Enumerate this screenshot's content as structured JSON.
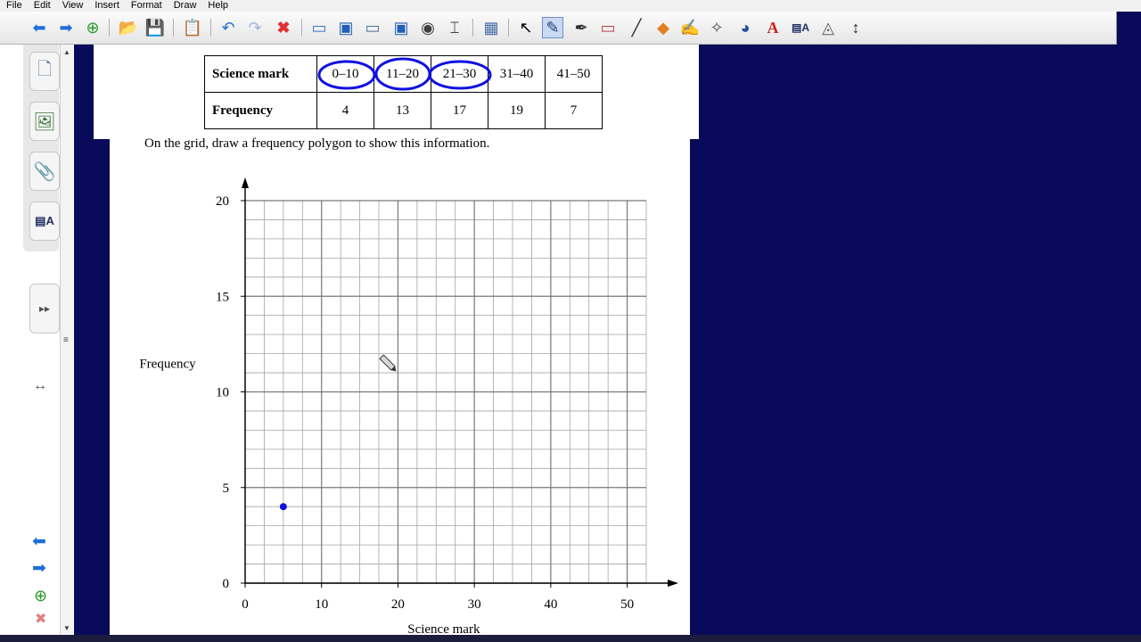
{
  "menu": [
    "File",
    "Edit",
    "View",
    "Insert",
    "Format",
    "Draw",
    "Help"
  ],
  "toolbar_icons": [
    "back-arrow-icon",
    "forward-arrow-icon",
    "add-page-icon",
    "open-folder-icon",
    "save-icon",
    "paste-icon",
    "undo-icon",
    "redo-icon",
    "delete-icon",
    "screen-shade-icon",
    "full-screen-icon",
    "dual-display-icon",
    "screen-capture-icon",
    "record-icon",
    "spotlight-icon",
    "table-icon",
    "select-arrow-icon",
    "pen-icon",
    "creative-pen-icon",
    "eraser-icon",
    "line-icon",
    "shape-icon",
    "magic-pen-icon",
    "recognition-pen-icon",
    "fill-icon",
    "text-icon",
    "spelling-icon",
    "measure-tool-icon",
    "move-toolbar-icon"
  ],
  "table": {
    "row1_header": "Science mark",
    "row2_header": "Frequency",
    "marks": [
      "0–10",
      "11–20",
      "21–30",
      "31–40",
      "41–50"
    ],
    "frequencies": [
      "4",
      "13",
      "17",
      "19",
      "7"
    ]
  },
  "instruction": "On the grid, draw a frequency polygon to show this information.",
  "chart_data": {
    "type": "scatter",
    "xlabel": "Science mark",
    "ylabel": "Frequency",
    "xlim": [
      0,
      52.5
    ],
    "ylim": [
      0,
      20
    ],
    "x_ticks": [
      0,
      10,
      20,
      30,
      40,
      50
    ],
    "y_ticks": [
      0,
      5,
      10,
      15,
      20
    ],
    "x_tick_labels": [
      "0",
      "10",
      "20",
      "30",
      "40",
      "50"
    ],
    "y_tick_labels": [
      "0",
      "5",
      "10",
      "15",
      "20"
    ],
    "grid": true,
    "x_minor_step": 2.5,
    "y_minor_step": 1,
    "points": [
      {
        "x": 5,
        "y": 4
      }
    ],
    "ink_color": "#1010e0"
  },
  "colors": {
    "background": "#0a0a5a",
    "ink": "#1010e0"
  }
}
